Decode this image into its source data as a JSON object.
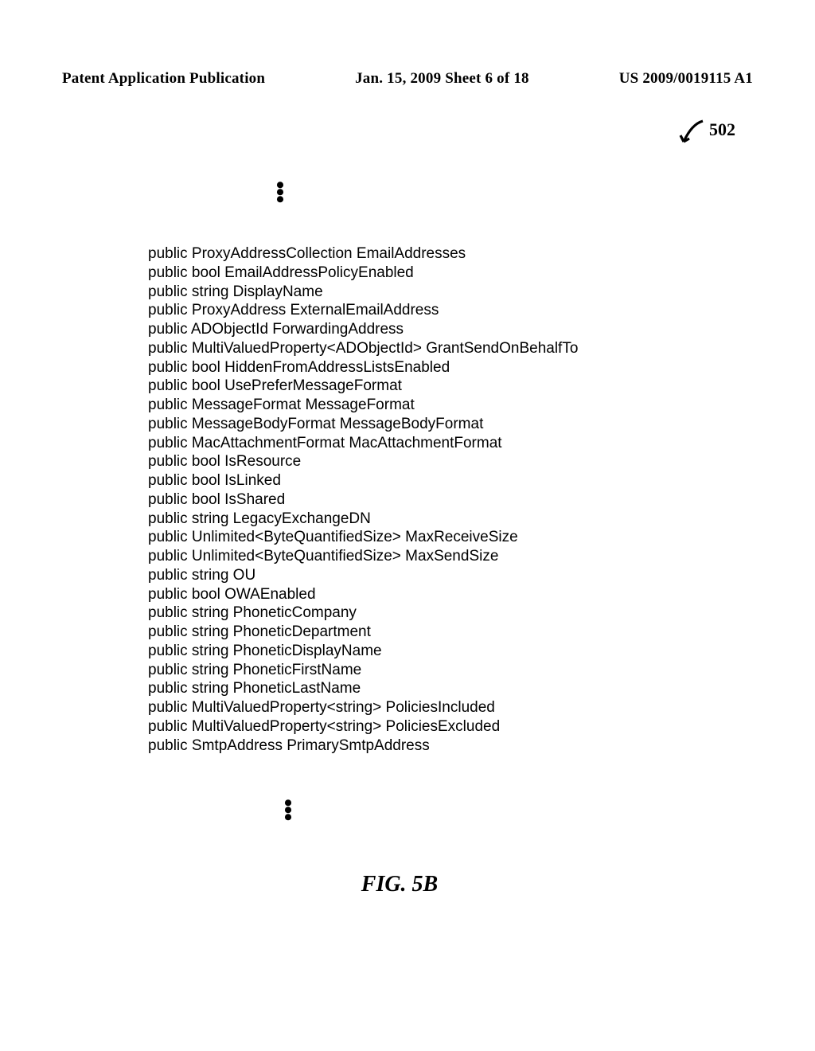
{
  "header": {
    "left": "Patent Application Publication",
    "center": "Jan. 15, 2009  Sheet 6 of 18",
    "right": "US 2009/0019115 A1"
  },
  "reference_number": "502",
  "code_lines": [
    "public ProxyAddressCollection EmailAddresses",
    "public bool EmailAddressPolicyEnabled",
    "public string DisplayName",
    "public ProxyAddress ExternalEmailAddress",
    "public ADObjectId ForwardingAddress",
    "public MultiValuedProperty<ADObjectId> GrantSendOnBehalfTo",
    "public bool HiddenFromAddressListsEnabled",
    "public bool UsePreferMessageFormat",
    "public MessageFormat MessageFormat",
    "public MessageBodyFormat MessageBodyFormat",
    "public MacAttachmentFormat MacAttachmentFormat",
    "public bool IsResource",
    "public bool IsLinked",
    "public bool IsShared",
    "public string LegacyExchangeDN",
    "public Unlimited<ByteQuantifiedSize> MaxReceiveSize",
    "public Unlimited<ByteQuantifiedSize> MaxSendSize",
    "public string OU",
    "public bool OWAEnabled",
    "public string PhoneticCompany",
    "public string PhoneticDepartment",
    "public string PhoneticDisplayName",
    "public string PhoneticFirstName",
    "public string PhoneticLastName",
    "public MultiValuedProperty<string> PoliciesIncluded",
    "public MultiValuedProperty<string> PoliciesExcluded",
    "public SmtpAddress PrimarySmtpAddress"
  ],
  "figure_caption": "FIG. 5B",
  "vdots": "⋮"
}
